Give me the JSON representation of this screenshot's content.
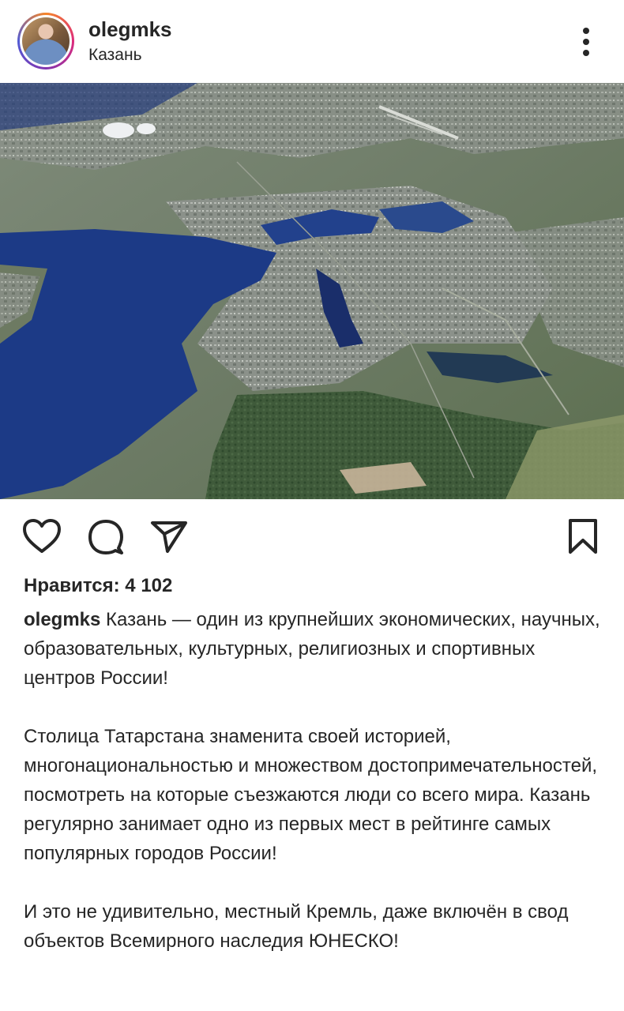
{
  "post": {
    "username": "olegmks",
    "location": "Казань",
    "likes_text": "Нравится: 4 102",
    "caption": {
      "user": "olegmks",
      "paragraph1": "Казань — один из крупнейших экономических, научных, образовательных, культурных, религиозных и спортивных центров России!",
      "paragraph2": "Столица Татарстана знаменита своей историей, многонациональностью и множеством достопримечательностей, посмотреть на которые съезжаются люди со всего мира. Казань регулярно занимает одно из первых мест в рейтинге самых популярных городов России!",
      "paragraph3": "И это не удивительно, местный Кремль, даже включён в свод объектов Всемирного наследия ЮНЕСКО!"
    }
  },
  "icons": {
    "more": "more-vertical-icon",
    "like": "heart-icon",
    "comment": "comment-icon",
    "share": "send-icon",
    "save": "bookmark-icon"
  },
  "colors": {
    "text": "#262626",
    "water": "#1c3a86"
  }
}
